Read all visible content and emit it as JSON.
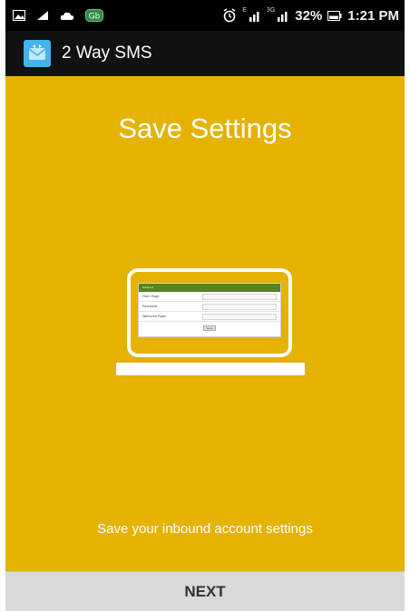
{
  "status_bar": {
    "icons_left": [
      "image-icon",
      "signal-arrow-icon",
      "cloud-icon",
      "gb-notification-icon"
    ],
    "gb_label": "Gb",
    "network_1": "E",
    "network_2": "3G",
    "battery_percent": "32%",
    "time": "1:21 PM"
  },
  "app_bar": {
    "title": "2 Way SMS",
    "icon": "app-icon"
  },
  "main": {
    "title": "Save Settings",
    "description": "Save your inbound account settings",
    "background_color": "#e5b200",
    "illustration": {
      "form_header": "Inbound",
      "fields": [
        "From Page",
        "Password",
        "Welcome Page"
      ],
      "button": "Save"
    }
  },
  "footer": {
    "next_label": "NEXT"
  }
}
